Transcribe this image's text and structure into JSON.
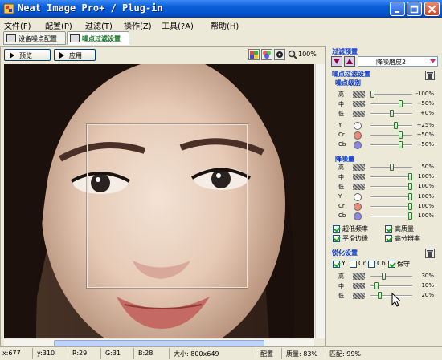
{
  "window": {
    "title": "Neat Image Pro+ / Plug-in"
  },
  "menu": [
    "文件(F)",
    "配置(P)",
    "过滤(T)",
    "操作(Z)",
    "工具(?A)",
    "帮助(H)"
  ],
  "tabs": [
    {
      "label": "设备噪点配置",
      "active": false
    },
    {
      "label": "噪点过滤设置",
      "active": true
    }
  ],
  "toolbar": {
    "preview_label": "预览",
    "apply_label": "应用",
    "zoom": "100%"
  },
  "right": {
    "filter_preset_header": "过滤预置",
    "preset_value": "降噪磨皮2",
    "noise_settings_header": "噪点过滤设置",
    "noise_level_header": "噪点级别",
    "noise_levels": [
      {
        "label": "高",
        "value": "-100%",
        "pos": 0.0
      },
      {
        "label": "中",
        "value": "+50%",
        "pos": 0.75
      },
      {
        "label": "低",
        "value": "+0%",
        "pos": 0.5
      }
    ],
    "noise_channels": [
      {
        "label": "Y",
        "value": "+25%",
        "pos": 0.62,
        "color": "#ffffff"
      },
      {
        "label": "Cr",
        "value": "+50%",
        "pos": 0.75,
        "color": "#f08878"
      },
      {
        "label": "Cb",
        "value": "+50%",
        "pos": 0.75,
        "color": "#8c88e8"
      }
    ],
    "reduction_header": "降噪量",
    "reduction_levels": [
      {
        "label": "高",
        "value": "50%",
        "pos": 0.5
      },
      {
        "label": "中",
        "value": "100%",
        "pos": 1.0
      },
      {
        "label": "低",
        "value": "100%",
        "pos": 1.0
      }
    ],
    "reduction_channels": [
      {
        "label": "Y",
        "value": "100%",
        "pos": 1.0,
        "color": "#ffffff"
      },
      {
        "label": "Cr",
        "value": "100%",
        "pos": 1.0,
        "color": "#f08878"
      },
      {
        "label": "Cb",
        "value": "100%",
        "pos": 1.0,
        "color": "#8c88e8"
      }
    ],
    "options": [
      {
        "label": "超低频率",
        "checked": true
      },
      {
        "label": "高质量",
        "checked": true
      },
      {
        "label": "平滑边缘",
        "checked": true
      },
      {
        "label": "高分辩率",
        "checked": true
      }
    ],
    "sharpen_header": "锐化设置",
    "sharpen_channels": [
      {
        "label": "Y",
        "checked": true
      },
      {
        "label": "Cr",
        "checked": false
      },
      {
        "label": "Cb",
        "checked": false
      },
      {
        "label": "保守",
        "checked": true
      }
    ],
    "sharpen_levels": [
      {
        "label": "高",
        "value": "30%",
        "pos": 0.3
      },
      {
        "label": "中",
        "value": "10%",
        "pos": 0.1
      },
      {
        "label": "低",
        "value": "20%",
        "pos": 0.2
      }
    ]
  },
  "status": {
    "x": "x:677",
    "y": "y:310",
    "r": "R:29",
    "g": "G:31",
    "b": "B:28",
    "size": "大小: 800x649",
    "config": "配置",
    "quality": "质量: 83%",
    "match": "匹配: 99%"
  }
}
